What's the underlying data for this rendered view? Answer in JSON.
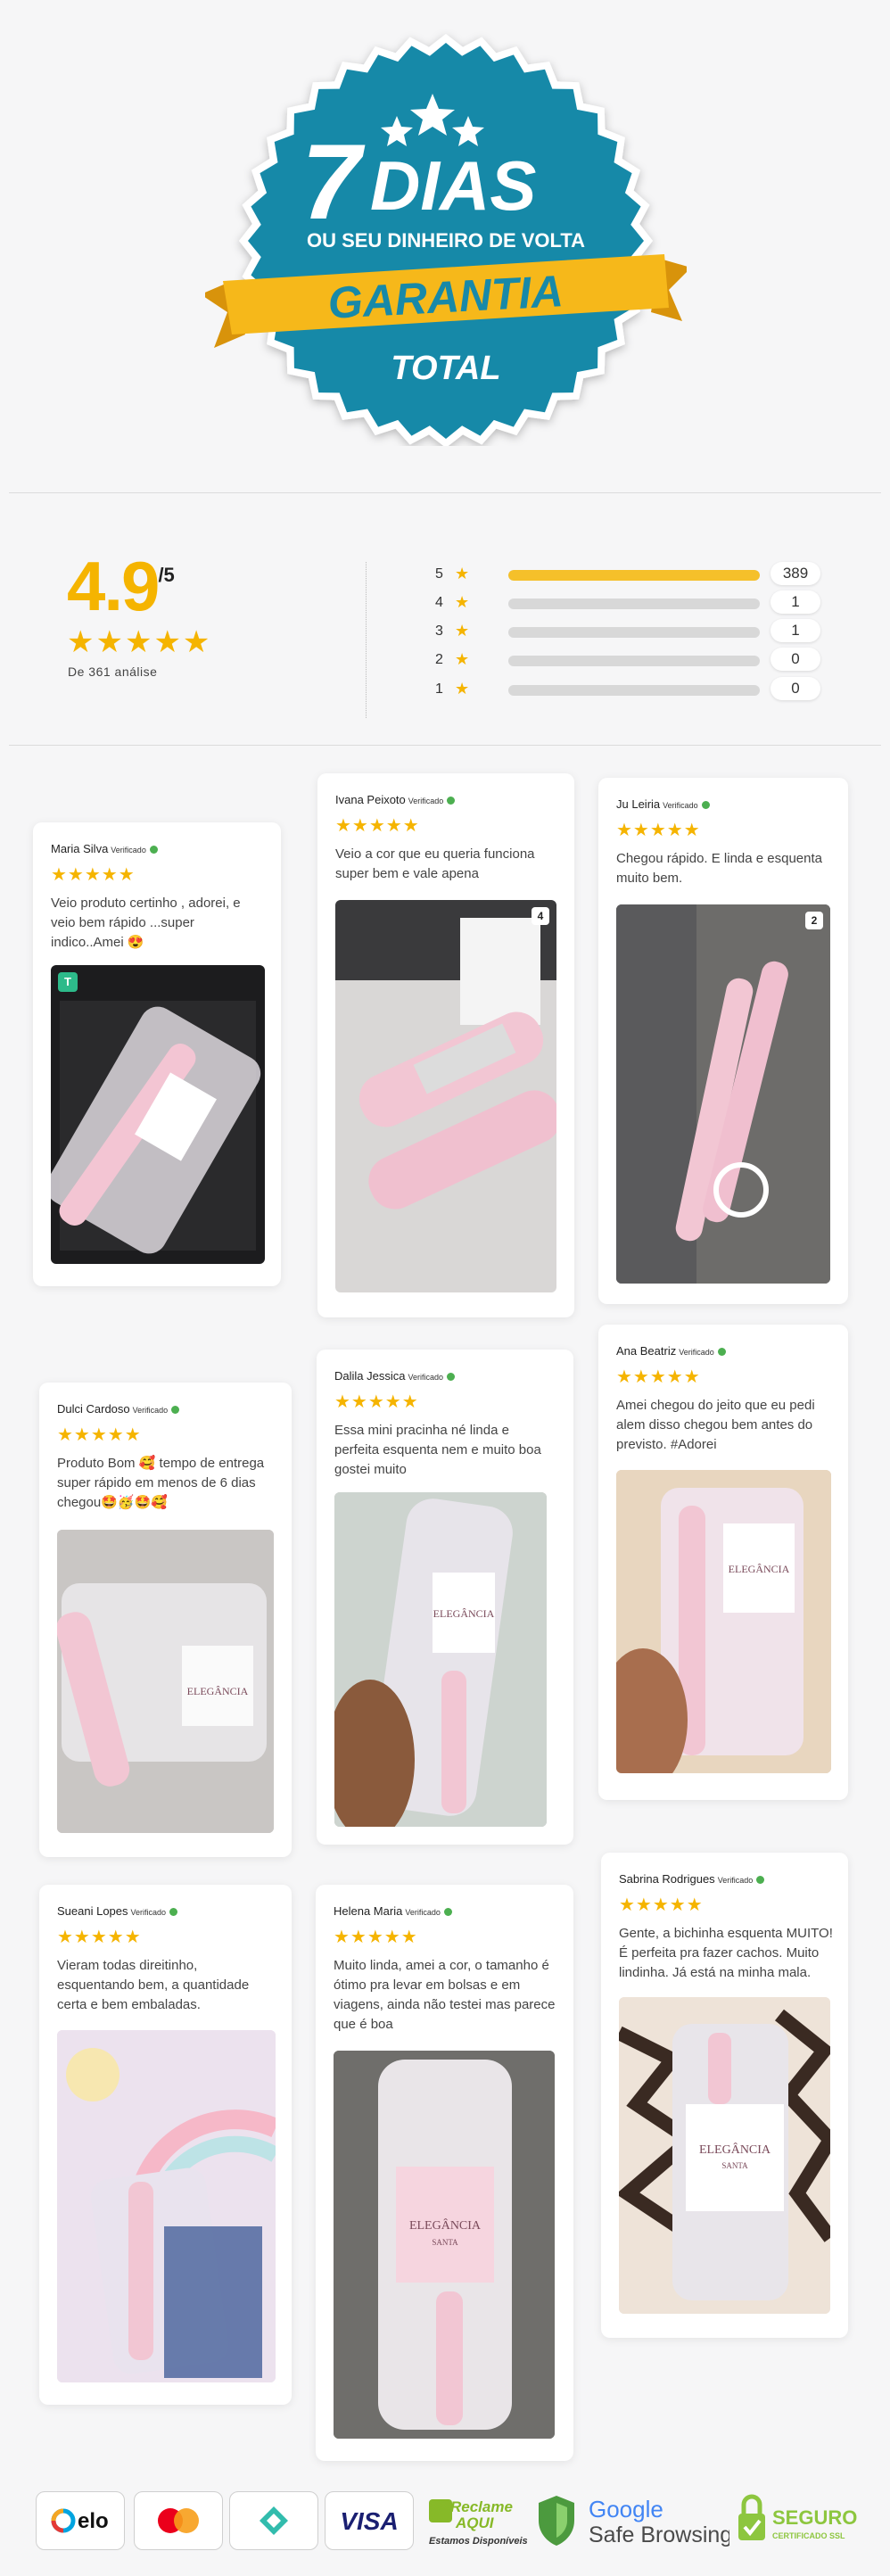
{
  "guarantee": {
    "number": "7",
    "dias": "DIAS",
    "subtitle": "OU SEU DINHEIRO DE VOLTA",
    "ribbon": "GARANTIA",
    "bottom": "TOTAL",
    "colors": {
      "teal": "#1889a8",
      "yellow": "#f6b81a",
      "white": "#ffffff"
    }
  },
  "summary": {
    "score": "4.9",
    "out_of": "/5",
    "stars": "★★★★★",
    "count_text": "De 361 análise",
    "rows": [
      {
        "stars": "5",
        "count": "389",
        "fill": 1.0
      },
      {
        "stars": "4",
        "count": "1",
        "fill": 0.0
      },
      {
        "stars": "3",
        "count": "1",
        "fill": 0.0
      },
      {
        "stars": "2",
        "count": "0",
        "fill": 0.0
      },
      {
        "stars": "1",
        "count": "0",
        "fill": 0.0
      }
    ],
    "star_glyph": "★"
  },
  "reviews": [
    {
      "name": "Maria Silva",
      "verified": "Verificado",
      "stars": "★★★★★",
      "text": "Veio produto certinho , adorei, e veio bem rápido ...super indico..Amei 😍",
      "photo_badge": "T"
    },
    {
      "name": "Ivana Peixoto",
      "verified": "Verificado",
      "stars": "★★★★★",
      "text": "Veio a cor que eu queria funciona super bem e vale apena",
      "photo_count": "4"
    },
    {
      "name": "Ju Leiria",
      "verified": "Verificado",
      "stars": "★★★★★",
      "text": "Chegou rápido. E linda e esquenta muito bem.",
      "photo_count": "2"
    },
    {
      "name": "Dulci Cardoso",
      "verified": "Verificado",
      "stars": "★★★★★",
      "text": "Produto Bom 🥰 tempo de entrega super rápido em menos de 6 dias chegou🤩🥳🤩🥰"
    },
    {
      "name": "Dalila Jessica",
      "verified": "Verificado",
      "stars": "★★★★★",
      "text": "Essa mini pracinha né linda e perfeita esquenta nem e muito boa gostei muito"
    },
    {
      "name": "Ana Beatriz",
      "verified": "Verificado",
      "stars": "★★★★★",
      "text": "Amei chegou do jeito que eu pedi alem disso chegou bem antes do previsto. #Adorei"
    },
    {
      "name": "Sueani Lopes",
      "verified": "Verificado",
      "stars": "★★★★★",
      "text": "Vieram todas direitinho, esquentando bem, a quantidade certa e bem embaladas."
    },
    {
      "name": "Helena Maria",
      "verified": "Verificado",
      "stars": "★★★★★",
      "text": "Muito linda, amei a cor, o tamanho é ótimo pra levar em bolsas e em viagens, ainda não testei mas parece que é boa"
    },
    {
      "name": "Sabrina Rodrigues",
      "verified": "Verificado",
      "stars": "★★★★★",
      "text": "Gente, a bichinha esquenta MUITO! É perfeita pra fazer cachos. Muito lindinha. Já está na minha mala."
    }
  ],
  "product_label": {
    "brand": "ELEGÂNCIA",
    "sub": "SANTA"
  },
  "footer": {
    "payments": [
      "elo",
      "mastercard",
      "pix",
      "VISA"
    ],
    "reclame": {
      "line1": "Reclame",
      "line2": "AQUI",
      "line3": "Estamos Disponíveis"
    },
    "google": {
      "brand": "Google",
      "text": "Safe Browsing"
    },
    "ssl": {
      "line1": "SEGURO",
      "line2": "CERTIFICADO SSL"
    }
  }
}
